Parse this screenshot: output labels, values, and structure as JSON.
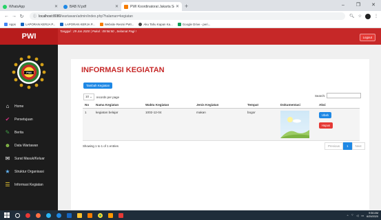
{
  "browser": {
    "tabs": [
      {
        "title": "WhatsApp",
        "color": "#25d366",
        "active": false
      },
      {
        "title": "BAB IV.pdf",
        "color": "#1e88e5",
        "active": false
      },
      {
        "title": "PWI Koordinatorat Jakarta Selata",
        "color": "#f57c00",
        "active": true
      }
    ],
    "url_host": "localhost:8080",
    "url_path": "/wartawan/admin/index.php?halaman=kegiatan",
    "bookmarks": [
      {
        "label": "Apps",
        "color": "#4285f4"
      },
      {
        "label": "LAPORAN KERJA P...",
        "color": "#1565c0"
      },
      {
        "label": "LAPORAN KERJA P...",
        "color": "#1565c0"
      },
      {
        "label": "Website Resmi PWI...",
        "color": "#f57c00"
      },
      {
        "label": "Aku Tahu Kapan Ka...",
        "color": "#444444"
      },
      {
        "label": "Google Drive - peri...",
        "color": "#0f9d58"
      }
    ]
  },
  "app": {
    "brand": "PWI",
    "topbar_info": "Tanggal : 29 Jun 2020 | Pukul : 09:56:50 , Selamat Pagi !",
    "logout_label": "Logout",
    "menu": [
      {
        "label": "Home",
        "icon": "home-icon",
        "color": "#ffffff"
      },
      {
        "label": "Persetujuan",
        "icon": "check-icon",
        "color": "#d63384"
      },
      {
        "label": "Berita",
        "icon": "edit-icon",
        "color": "#43a047"
      },
      {
        "label": "Data Wartawan",
        "icon": "users-icon",
        "color": "#8bc34a"
      },
      {
        "label": "Surat Masuk/Keluar",
        "icon": "mail-icon",
        "color": "#ffffff"
      },
      {
        "label": "Struktur Organisasi",
        "icon": "star-icon",
        "color": "#64b5f6"
      },
      {
        "label": "Informasi Kegiatan",
        "icon": "list-icon",
        "color": "#fdd835"
      }
    ]
  },
  "page": {
    "title": "INFORMASI KEGIATAN",
    "add_button": "Tambah Kegiatan",
    "per_page_value": "10",
    "per_page_label": "records per page",
    "search_label": "Search:",
    "columns": [
      "No",
      "Nama Kegiatan",
      "Waktu Kegiatan",
      "Jenis Kegiatan",
      "Tempat",
      "Dokumentasi",
      "Aksi"
    ],
    "rows": [
      {
        "no": "1",
        "nama": "kegiatan belajar",
        "waktu": "1002-12-04",
        "jenis": "makan",
        "tempat": "bogor",
        "ubah": "Ubah",
        "hapus": "Hapus"
      }
    ],
    "showing": "Showing 1 to 1 of 1 entries",
    "pager": {
      "prev": "Previous",
      "current": "1",
      "next": "Next"
    }
  },
  "taskbar": {
    "time": "9:56 AM",
    "date": "6/29/2020"
  }
}
